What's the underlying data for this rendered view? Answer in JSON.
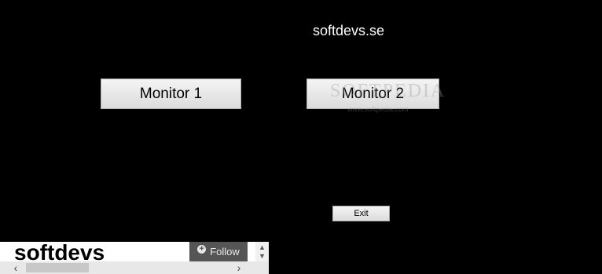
{
  "header": {
    "site_title": "softdevs.se"
  },
  "buttons": {
    "monitor1_label": "Monitor 1",
    "monitor2_label": "Monitor 2",
    "exit_label": "Exit"
  },
  "watermark": {
    "main": "SOFTPEDIA",
    "sub": "www.softpedia.com"
  },
  "widget": {
    "brand": "softdevs",
    "follow_label": "Follow",
    "follow_icon": "plus-circle-icon",
    "scroll_up_icon": "chevron-up-icon",
    "scroll_down_icon": "chevron-down-icon",
    "scroll_left_icon": "chevron-left-icon",
    "scroll_right_icon": "chevron-right-icon"
  },
  "colors": {
    "background": "#000000",
    "button_face": "#e6e6e6",
    "follow_bg": "#555555"
  }
}
